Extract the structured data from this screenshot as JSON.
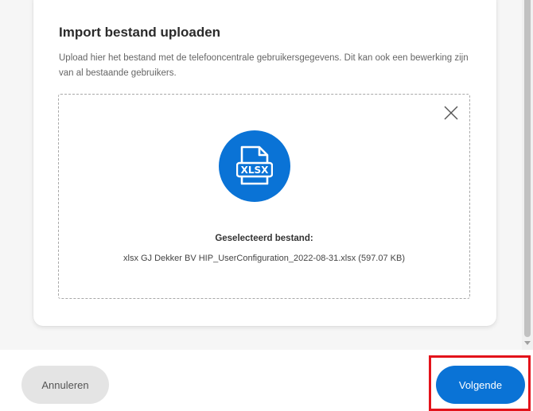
{
  "card": {
    "title": "Import bestand uploaden",
    "description": "Upload hier het bestand met de telefooncentrale gebruikersgegevens. Dit kan ook een bewerking zijn van al bestaande gebruikers."
  },
  "upload": {
    "file_type_label": "XLSX",
    "file_icon": "xlsx-file-icon",
    "close_icon": "close-icon",
    "selected_label": "Geselecteerd bestand:",
    "selected_file": "xlsx GJ Dekker BV HIP_UserConfiguration_2022-08-31.xlsx (597.07 KB)"
  },
  "footer": {
    "cancel_label": "Annuleren",
    "next_label": "Volgende"
  },
  "colors": {
    "primary": "#0a73d6",
    "highlight": "#e3131b",
    "cancel_bg": "#e4e4e4"
  }
}
